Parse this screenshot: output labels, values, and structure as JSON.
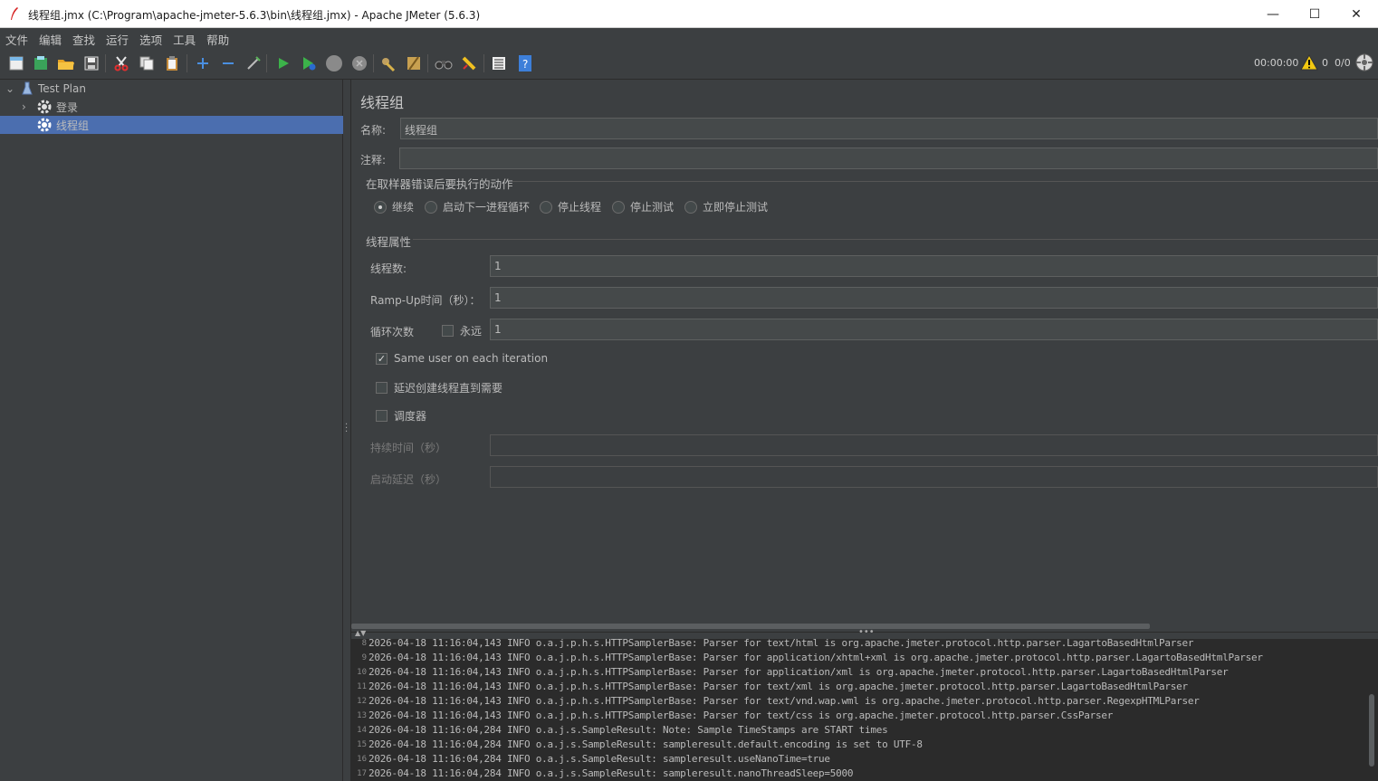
{
  "window": {
    "title": "线程组.jmx (C:\\Program\\apache-jmeter-5.6.3\\bin\\线程组.jmx) - Apache JMeter (5.6.3)",
    "minimize": "—",
    "maximize": "☐",
    "close": "✕"
  },
  "menu": [
    "文件",
    "编辑",
    "查找",
    "运行",
    "选项",
    "工具",
    "帮助"
  ],
  "toolbar": {
    "timer": "00:00:00",
    "warnings": "0",
    "threads": "0/0"
  },
  "tree": {
    "root": "Test Plan",
    "items": [
      {
        "label": "登录"
      },
      {
        "label": "线程组"
      }
    ]
  },
  "panel": {
    "title": "线程组",
    "name_label": "名称:",
    "name_value": "线程组",
    "comment_label": "注释:",
    "comment_value": "",
    "error_group_title": "在取样器错误后要执行的动作",
    "error_actions": [
      "继续",
      "启动下一进程循环",
      "停止线程",
      "停止测试",
      "立即停止测试"
    ],
    "error_selected_index": 0,
    "thread_group_title": "线程属性",
    "threads_label": "线程数:",
    "threads_value": "1",
    "rampup_label": "Ramp-Up时间（秒）：",
    "rampup_value": "1",
    "loop_label": "循环次数",
    "forever_label": "永远",
    "loop_value": "1",
    "same_user_label": "Same user on each iteration",
    "same_user_checked": true,
    "delay_label": "延迟创建线程直到需要",
    "scheduler_label": "调度器",
    "duration_label": "持续时间（秒）",
    "startup_label": "启动延迟（秒）"
  },
  "log": [
    {
      "n": "8",
      "text": "2026-04-18 11:16:04,143 INFO o.a.j.p.h.s.HTTPSamplerBase: Parser for text/html is org.apache.jmeter.protocol.http.parser.LagartoBasedHtmlParser"
    },
    {
      "n": "9",
      "text": "2026-04-18 11:16:04,143 INFO o.a.j.p.h.s.HTTPSamplerBase: Parser for application/xhtml+xml is org.apache.jmeter.protocol.http.parser.LagartoBasedHtmlParser"
    },
    {
      "n": "10",
      "text": "2026-04-18 11:16:04,143 INFO o.a.j.p.h.s.HTTPSamplerBase: Parser for application/xml is org.apache.jmeter.protocol.http.parser.LagartoBasedHtmlParser"
    },
    {
      "n": "11",
      "text": "2026-04-18 11:16:04,143 INFO o.a.j.p.h.s.HTTPSamplerBase: Parser for text/xml is org.apache.jmeter.protocol.http.parser.LagartoBasedHtmlParser"
    },
    {
      "n": "12",
      "text": "2026-04-18 11:16:04,143 INFO o.a.j.p.h.s.HTTPSamplerBase: Parser for text/vnd.wap.wml is org.apache.jmeter.protocol.http.parser.RegexpHTMLParser"
    },
    {
      "n": "13",
      "text": "2026-04-18 11:16:04,143 INFO o.a.j.p.h.s.HTTPSamplerBase: Parser for text/css is org.apache.jmeter.protocol.http.parser.CssParser"
    },
    {
      "n": "14",
      "text": "2026-04-18 11:16:04,284 INFO o.a.j.s.SampleResult: Note: Sample TimeStamps are START times"
    },
    {
      "n": "15",
      "text": "2026-04-18 11:16:04,284 INFO o.a.j.s.SampleResult: sampleresult.default.encoding is set to UTF-8"
    },
    {
      "n": "16",
      "text": "2026-04-18 11:16:04,284 INFO o.a.j.s.SampleResult: sampleresult.useNanoTime=true"
    },
    {
      "n": "17",
      "text": "2026-04-18 11:16:04,284 INFO o.a.j.s.SampleResult: sampleresult.nanoThreadSleep=5000"
    }
  ],
  "colors": {
    "background": "#3c3f41",
    "selection": "#4b6eaf",
    "log_background": "#2b2b2b",
    "start_green": "#3cb34a",
    "help_blue": "#3d7fd9"
  }
}
